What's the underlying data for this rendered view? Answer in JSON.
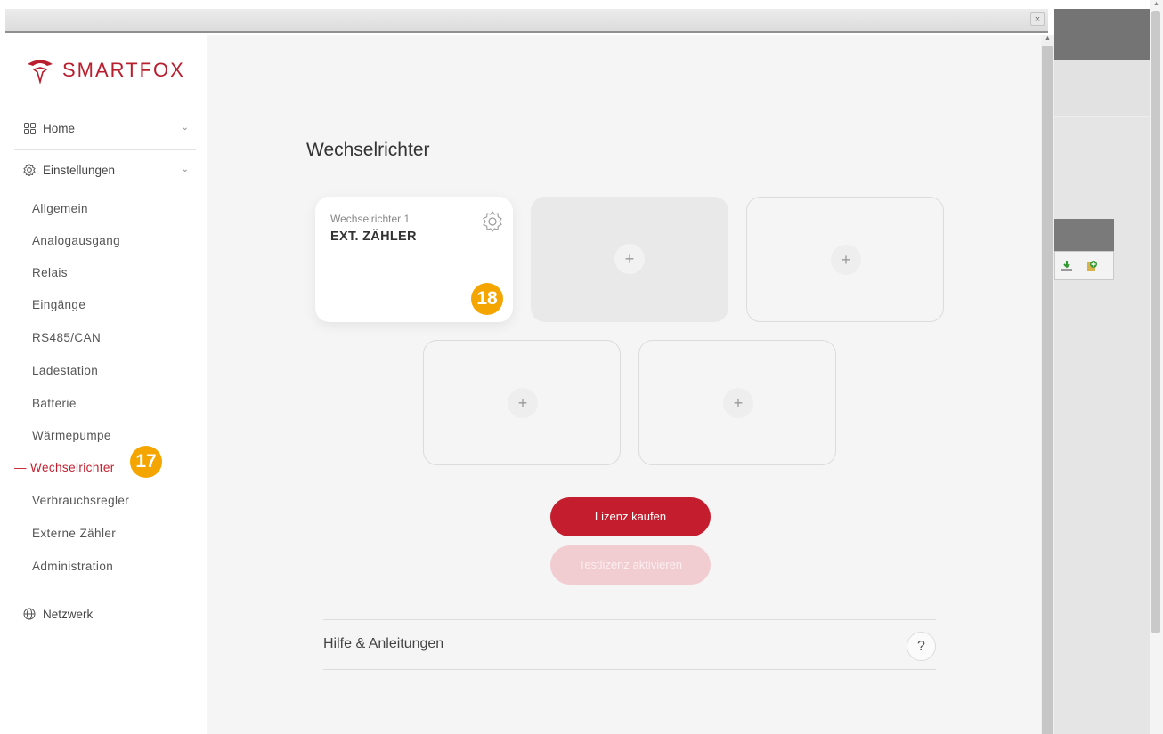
{
  "brand": {
    "name": "SMARTFOX",
    "color": "#b81e2d"
  },
  "window": {
    "close_label": "×"
  },
  "sidebar": {
    "home": {
      "label": "Home",
      "icon": "grid-icon"
    },
    "settings": {
      "label": "Einstellungen",
      "icon": "gear-icon"
    },
    "items": [
      {
        "label": "Allgemein"
      },
      {
        "label": "Analogausgang"
      },
      {
        "label": "Relais"
      },
      {
        "label": "Eingänge"
      },
      {
        "label": "RS485/CAN"
      },
      {
        "label": "Ladestation"
      },
      {
        "label": "Batterie"
      },
      {
        "label": "Wärmepumpe"
      },
      {
        "label": "— Wechselrichter",
        "active": true
      },
      {
        "label": "Verbrauchsregler"
      },
      {
        "label": "Externe Zähler"
      },
      {
        "label": "Administration"
      }
    ],
    "network": {
      "label": "Netzwerk",
      "icon": "globe-icon"
    }
  },
  "annotations": {
    "badge_sidebar": "17",
    "badge_card": "18",
    "color": "#f5a500"
  },
  "main": {
    "title": "Wechselrichter",
    "card": {
      "subtitle": "Wechselrichter 1",
      "title": "EXT. ZÄHLER"
    },
    "add_symbol": "+",
    "buttons": {
      "buy": "Lizenz kaufen",
      "test": "Testlizenz aktivieren"
    },
    "help": {
      "label": "Hilfe & Anleitungen",
      "icon_label": "?"
    }
  },
  "colors": {
    "accent": "#c41e2e",
    "accent_disabled": "#f1cdd1",
    "main_bg": "#f5f5f5"
  }
}
